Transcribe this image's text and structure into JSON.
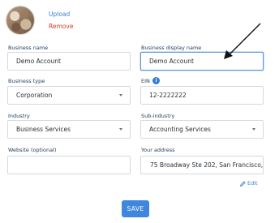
{
  "logo": {
    "upload_label": "Upload",
    "remove_label": "Remove"
  },
  "business_name": {
    "label": "Business name",
    "value": "Demo Account"
  },
  "display_name": {
    "label": "Business display name",
    "value": "Demo Account"
  },
  "business_type": {
    "label": "Business type",
    "value": "Corporation"
  },
  "ein": {
    "label": "EIN",
    "value": "12-2222222",
    "info_icon": "info-icon"
  },
  "industry": {
    "label": "Industry",
    "value": "Business Services"
  },
  "sub_industry": {
    "label": "Sub-industry",
    "value": "Accounting Services"
  },
  "website": {
    "label": "Website (optional)",
    "value": ""
  },
  "address": {
    "label": "Your address",
    "value": "75 Broadway Ste 202, San Francisco, C",
    "edit_label": "Edit"
  },
  "save_label": "SAVE",
  "colors": {
    "accent": "#3f86de",
    "remove": "#d33a2c",
    "label": "#23415f"
  }
}
